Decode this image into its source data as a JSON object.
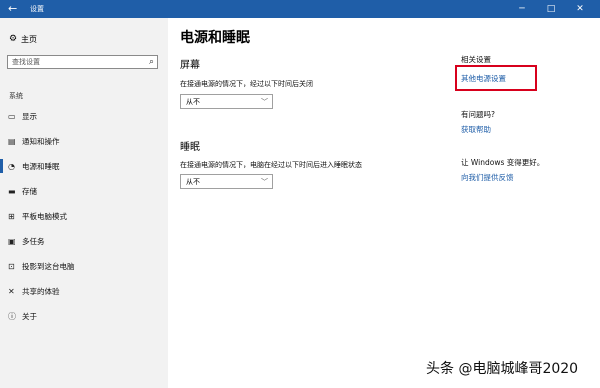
{
  "window": {
    "back_icon": "←",
    "title": "设置",
    "minimize_icon": "─",
    "maximize_icon": "□",
    "close_icon": "✕"
  },
  "sidebar": {
    "home": {
      "icon": "gear-icon",
      "glyph": "⚙",
      "label": "主页"
    },
    "search": {
      "placeholder": "查找设置",
      "glyph": "⌕"
    },
    "section": "系统",
    "items": [
      {
        "name": "display",
        "glyph": "▭",
        "label": "显示"
      },
      {
        "name": "notifications",
        "glyph": "▤",
        "label": "通知和操作"
      },
      {
        "name": "power",
        "glyph": "◔",
        "label": "电源和睡眠"
      },
      {
        "name": "storage",
        "glyph": "▬",
        "label": "存储"
      },
      {
        "name": "tablet",
        "glyph": "⊞",
        "label": "平板电脑模式"
      },
      {
        "name": "multitasking",
        "glyph": "▣",
        "label": "多任务"
      },
      {
        "name": "projecting",
        "glyph": "⊡",
        "label": "投影到这台电脑"
      },
      {
        "name": "shared",
        "glyph": "✕",
        "label": "共享的体验"
      },
      {
        "name": "about",
        "glyph": "ⓘ",
        "label": "关于"
      }
    ],
    "active_index": 2
  },
  "main": {
    "title": "电源和睡眠",
    "screen": {
      "heading": "屏幕",
      "description": "在接通电源的情况下，经过以下时间后关闭",
      "value": "从不",
      "chevron": "﹀"
    },
    "sleep": {
      "heading": "睡眠",
      "description": "在接通电源的情况下，电脑在经过以下时间后进入睡眠状态",
      "value": "从不",
      "chevron": "﹀"
    }
  },
  "right": {
    "related_heading": "相关设置",
    "related_link": "其他电源设置",
    "question_heading": "有问题吗?",
    "help_link": "获取帮助",
    "feedback_heading": "让 Windows 变得更好。",
    "feedback_link": "向我们提供反馈",
    "highlight_color": "#d7001c",
    "link_color": "#1f5ea8"
  },
  "watermark": "头条 @电脑城峰哥2020"
}
